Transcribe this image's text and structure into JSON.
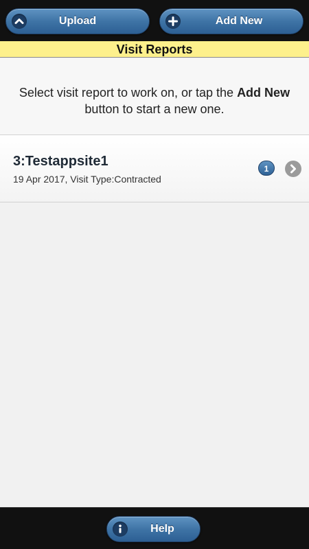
{
  "toolbar": {
    "upload_label": "Upload",
    "add_new_label": "Add New"
  },
  "page": {
    "title": "Visit Reports"
  },
  "intro": {
    "text_before": "Select visit report to work on, or tap the ",
    "text_bold": "Add New",
    "text_after": " button to start a new one."
  },
  "reports": [
    {
      "title": "3:Testappsite1",
      "subtitle": "19 Apr 2017, Visit Type:Contracted",
      "count": "1"
    }
  ],
  "footer": {
    "help_label": "Help"
  },
  "colors": {
    "accent": "#3f74a6",
    "title_bar": "#fdf08c",
    "bar_background": "#111111"
  },
  "icons": {
    "upload": "chevron-up-icon",
    "add_new": "plus-icon",
    "row": "chevron-right-icon",
    "help": "info-icon"
  }
}
